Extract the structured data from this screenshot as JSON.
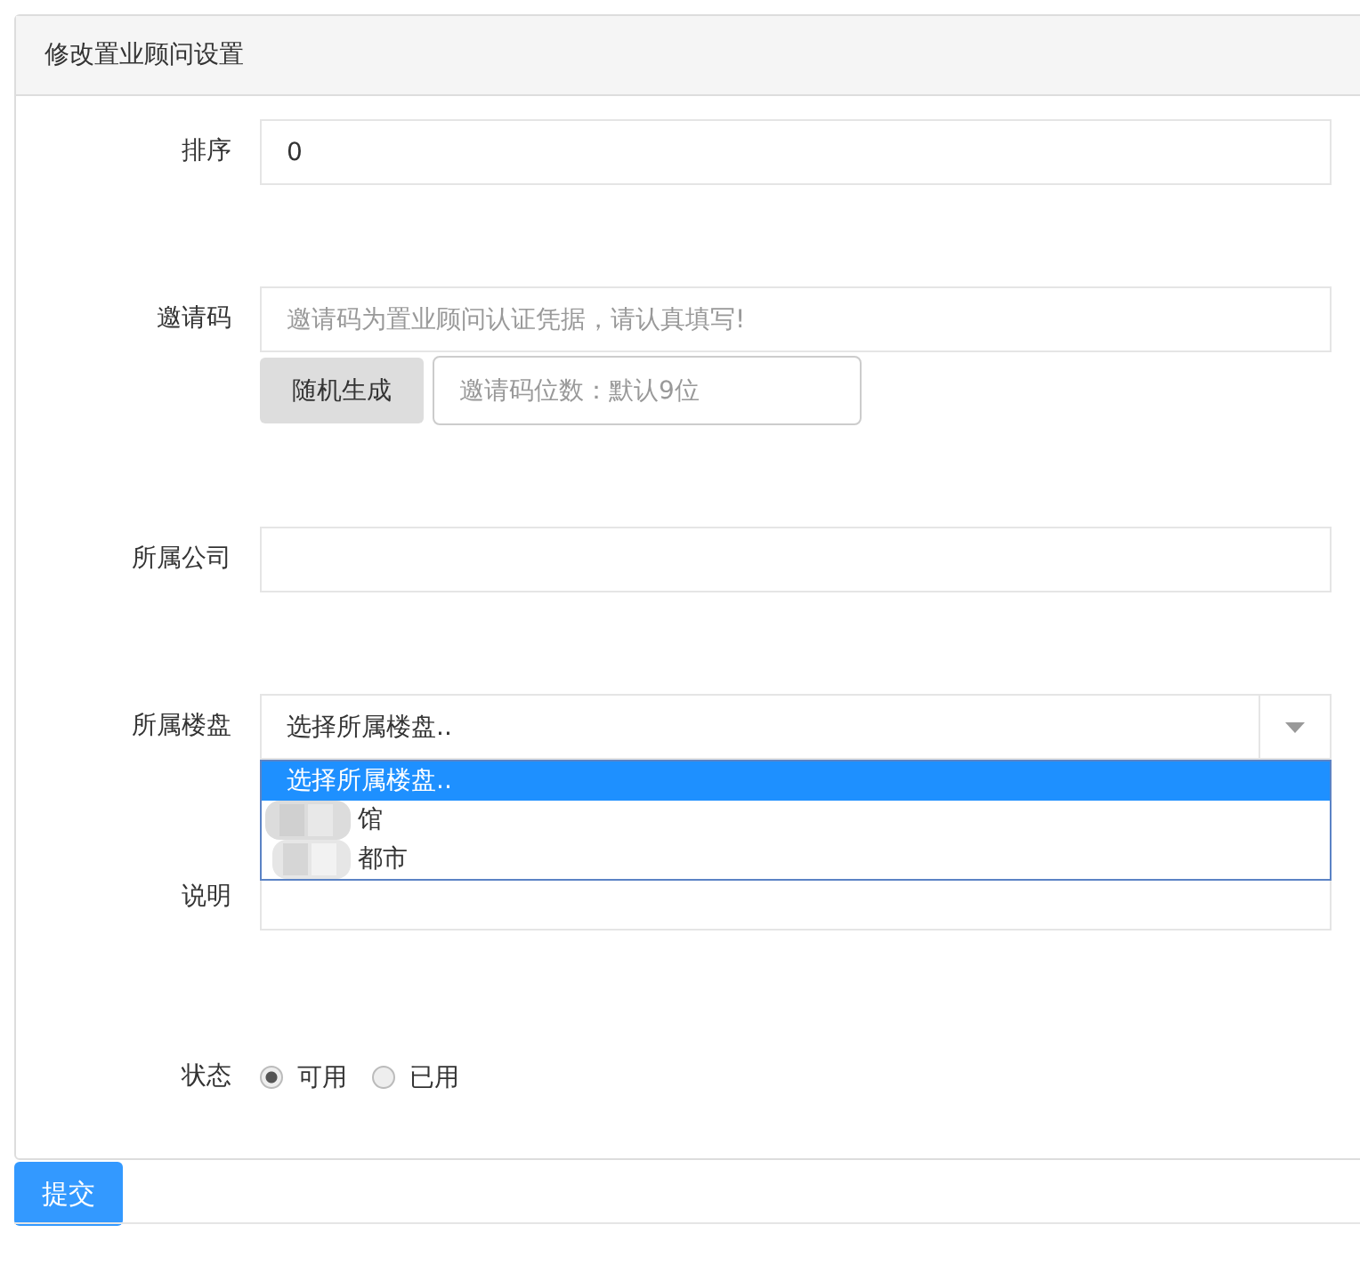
{
  "panel": {
    "title": "修改置业顾问设置"
  },
  "sort": {
    "label": "排序",
    "value": "0"
  },
  "invite": {
    "label": "邀请码",
    "placeholder": "邀请码为置业顾问认证凭据，请认真填写!",
    "generate_button": "随机生成",
    "digits_placeholder": "邀请码位数：默认9位"
  },
  "company": {
    "label": "所属公司"
  },
  "estate": {
    "label": "所属楼盘",
    "value": "选择所属楼盘..",
    "expanded": true,
    "options": [
      {
        "text": "选择所属楼盘..",
        "selected": true
      },
      {
        "text": "馆",
        "selected": false
      },
      {
        "text": "都市",
        "selected": false
      }
    ]
  },
  "note": {
    "label": "说明"
  },
  "status": {
    "label": "状态",
    "options": [
      {
        "text": "可用",
        "selected": true
      },
      {
        "text": "已用",
        "selected": false
      }
    ]
  },
  "submit": "提交"
}
